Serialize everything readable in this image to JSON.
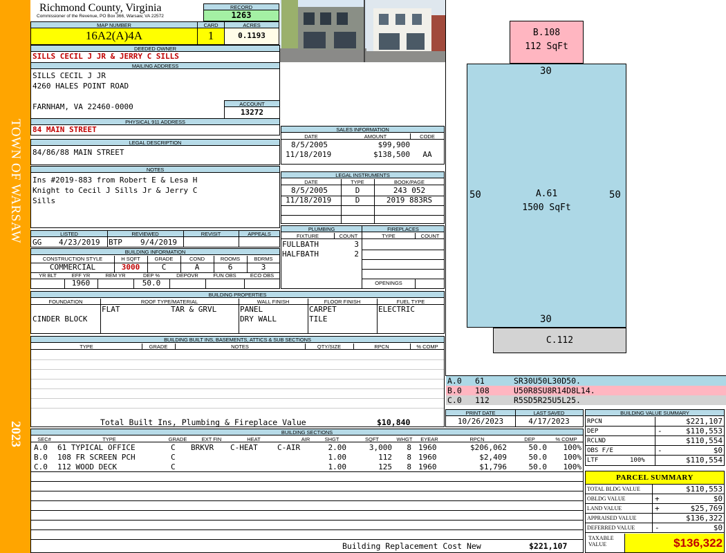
{
  "sidebar": {
    "town": "TOWN OF WARSAW",
    "year": "2023"
  },
  "header": {
    "county": "Richmond County, Virginia",
    "commissioner": "Commissioner of the Revenue, PO Box 366, Warsaw, VA 22572",
    "record_label": "RECORD",
    "record": "1263",
    "map_number_label": "MAP NUMBER",
    "map_number": "16A2(A)4A",
    "card_label": "CARD",
    "card": "1",
    "acres_label": "ACRES",
    "acres": "0.1193"
  },
  "owner": {
    "deeded_owner_label": "DEEDED OWNER",
    "deeded_owner": "SILLS CECIL J JR & JERRY C SILLS",
    "mailing_label": "MAILING ADDRESS",
    "mailing_lines": [
      "SILLS CECIL J JR",
      "4260 HALES POINT ROAD",
      "",
      "FARNHAM, VA 22460-0000"
    ],
    "account_label": "ACCOUNT",
    "account": "13272",
    "physical_label": "PHYSICAL 911 ADDRESS",
    "physical": "84 MAIN STREET"
  },
  "legal": {
    "label": "LEGAL DESCRIPTION",
    "text": "84/86/88 MAIN STREET"
  },
  "notes": {
    "label": "NOTES",
    "lines": [
      "Ins #2019-883 from Robert E & Lesa H",
      "Knight to Cecil J Sills Jr & Jerry C",
      "Sills"
    ]
  },
  "listing": {
    "listed_label": "LISTED",
    "reviewed_label": "REVIEWED",
    "revisit_label": "REVISIT",
    "appeals_label": "APPEALS",
    "listed_by": "GG",
    "listed_date": "4/23/2019",
    "reviewed_by": "BTP",
    "reviewed_date": "9/4/2019"
  },
  "building_info": {
    "label": "BUILDING INFORMATION",
    "h_style": "CONSTRUCTION STYLE",
    "h_hsqft": "H SQFT",
    "h_grade": "GRADE",
    "h_cond": "COND",
    "h_rooms": "ROOMS",
    "h_bdrms": "BDRMS",
    "style": "COMMERCIAL",
    "hsqft": "3000",
    "grade": "C",
    "cond": "A",
    "rooms": "6",
    "bdrms": "3",
    "h_yrblt": "YR BLT",
    "h_effyr": "EFF YR",
    "h_remyr": "REM YR",
    "h_dep": "DEP %",
    "h_depovr": "DEPOVR",
    "h_funobs": "FUN OBS",
    "h_ecoobs": "ECO OBS",
    "effyr": "1960",
    "dep": "50.0"
  },
  "sales": {
    "label": "SALES INFORMATION",
    "h_date": "DATE",
    "h_amount": "AMOUNT",
    "h_code": "CODE",
    "rows": [
      {
        "date": "8/5/2005",
        "amount": "$99,900",
        "code": ""
      },
      {
        "date": "11/18/2019",
        "amount": "$138,500",
        "code": "AA"
      }
    ]
  },
  "instruments": {
    "label": "LEGAL INSTRUMENTS",
    "h_date": "DATE",
    "h_type": "TYPE",
    "h_book": "BOOK/PAGE",
    "rows": [
      {
        "date": "8/5/2005",
        "type": "D",
        "book": "243 052"
      },
      {
        "date": "11/18/2019",
        "type": "D",
        "book": "2019 883RS"
      }
    ]
  },
  "plumbing": {
    "label": "PLUMBING",
    "h_fixture": "FIXTURE",
    "h_count": "COUNT",
    "rows": [
      {
        "fixture": "FULLBATH",
        "count": "3"
      },
      {
        "fixture": "HALFBATH",
        "count": "2"
      }
    ]
  },
  "fireplaces": {
    "label": "FIREPLACES",
    "h_type": "TYPE",
    "h_count": "COUNT",
    "openings_label": "OPENINGS"
  },
  "properties": {
    "label": "BUILDING PROPERTIES",
    "h_foundation": "FOUNDATION",
    "h_roof": "ROOF TYPE/MATERIAL",
    "h_wall": "WALL FINISH",
    "h_floor": "FLOOR FINISH",
    "h_fuel": "FUEL TYPE",
    "foundation": "CINDER BLOCK",
    "roof_type": "FLAT",
    "roof_material": "TAR & GRVL",
    "wall": [
      "PANEL",
      "DRY WALL"
    ],
    "floor": [
      "CARPET",
      "TILE"
    ],
    "fuel": "ELECTRIC"
  },
  "builtins": {
    "label": "BUILDING BUILT INS, BASEMENTS, ATTICS & SUB SECTIONS",
    "h_type": "TYPE",
    "h_grade": "GRADE",
    "h_notes": "NOTES",
    "h_qty": "QTY/SIZE",
    "h_rpcn": "RPCN",
    "h_comp": "% COMP",
    "total_label": "Total Built Ins, Plumbing & Fireplace Value",
    "total": "$10,840"
  },
  "sketch": {
    "b_label": "B.108",
    "b_area": "112 SqFt",
    "a_label": "A.61",
    "a_area": "1500 SqFt",
    "c_label": "C.112",
    "dim_top": "30",
    "dim_bottom": "30",
    "dim_left": "50",
    "dim_right": "50",
    "legend": [
      {
        "code": "A.0",
        "num": "61",
        "vec": "SR30U50L30D50."
      },
      {
        "code": "B.0",
        "num": "108",
        "vec": "U50R8SU8R14D8L14."
      },
      {
        "code": "C.0",
        "num": "112",
        "vec": "R5SD5R25U5L25."
      }
    ]
  },
  "dates": {
    "print_label": "PRINT DATE",
    "print": "10/26/2023",
    "saved_label": "LAST SAVED",
    "saved": "4/17/2023"
  },
  "value_summary": {
    "label": "BUILDING VALUE SUMMARY",
    "rows": [
      {
        "label": "RPCN",
        "sign": "",
        "value": "$221,107"
      },
      {
        "label": "DEP",
        "sign": "-",
        "value": "$110,553"
      },
      {
        "label": "RCLND",
        "sign": "",
        "value": "$110,554"
      },
      {
        "label": "OBS F/E",
        "sign": "-",
        "value": "$0"
      },
      {
        "label": "LTF",
        "pct": "100%",
        "sign": "",
        "value": "$110,554"
      }
    ]
  },
  "sections": {
    "label": "BUILDING SECTIONS",
    "h": [
      "SEC#",
      "TYPE",
      "GRADE",
      "EXT FIN",
      "HEAT",
      "AIR",
      "SHGT",
      "SQFT",
      "WHGT",
      "EYEAR",
      "RPCN",
      "DEP",
      "% COMP"
    ],
    "rows": [
      [
        "A.0",
        "61 TYPICAL OFFICE",
        "C",
        "BRKVR",
        "C-HEAT",
        "C-AIR",
        "2.00",
        "3,000",
        "8",
        "1960",
        "$206,062",
        "50.0",
        "100%"
      ],
      [
        "B.0",
        "108 FR SCREEN PCH",
        "C",
        "",
        "",
        "",
        "1.00",
        "112",
        "8",
        "1960",
        "$2,409",
        "50.0",
        "100%"
      ],
      [
        "C.0",
        "112 WOOD DECK",
        "C",
        "",
        "",
        "",
        "1.00",
        "125",
        "8",
        "1960",
        "$1,796",
        "50.0",
        "100%"
      ]
    ],
    "replacement_label": "Building Replacement Cost New",
    "replacement": "$221,107"
  },
  "parcel": {
    "title": "PARCEL SUMMARY",
    "rows": [
      {
        "label": "TOTAL BLDG VALUE",
        "sign": "",
        "value": "$110,553"
      },
      {
        "label": "OBLDG VALUE",
        "sign": "+",
        "value": "$0"
      },
      {
        "label": "LAND VALUE",
        "sign": "+",
        "value": "$25,769"
      },
      {
        "label": "APPRAISED VALUE",
        "sign": "",
        "value": "$136,322"
      },
      {
        "label": "DEFERRED VALUE",
        "sign": "-",
        "value": "$0"
      }
    ],
    "taxable_label": "TAXABLE VALUE",
    "taxable": "$136,322"
  },
  "colors": {
    "sidebar": "#ffa500",
    "header_band": "#b7dbe8",
    "yellow": "#ffff00",
    "green": "#a4f0a4",
    "red": "#c00000",
    "sketch_a": "#add8e6",
    "sketch_b": "#ffb6c1",
    "sketch_c": "#d3d3d3"
  }
}
